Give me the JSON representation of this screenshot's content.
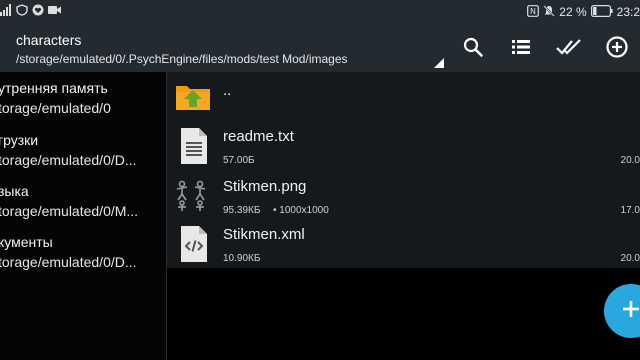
{
  "status_bar": {
    "left_icons": [
      "signal-icon",
      "shield-icon",
      "heart-icon",
      "video-icon"
    ],
    "right_icons": [
      "nfc-icon",
      "mute-icon"
    ],
    "battery_text": "22 %",
    "battery_level": 22,
    "time": "23:2"
  },
  "toolbar": {
    "title": "characters",
    "path": "/storage/emulated/0/.PsychEngine/files/mods/test Mod/images",
    "actions": [
      "search-icon",
      "list-view-icon",
      "select-all-icon",
      "add-icon"
    ]
  },
  "bookmarks": [
    {
      "name": "утренняя память",
      "path": "torage/emulated/0"
    },
    {
      "name": "грузки",
      "path": "torage/emulated/0/D..."
    },
    {
      "name": "зыка",
      "path": "torage/emulated/0/M..."
    },
    {
      "name": "кументы",
      "path": "torage/emulated/0/D..."
    }
  ],
  "files": [
    {
      "name": "..",
      "icon": "folder-up-icon",
      "size": "",
      "dims": "",
      "date": ""
    },
    {
      "name": "readme.txt",
      "icon": "text-file-icon",
      "size": "57.00Б",
      "dims": "",
      "date": "20.0"
    },
    {
      "name": "Stikmen.png",
      "icon": "image-thumbnail-icon",
      "size": "95.39КБ",
      "dims": "• 1000x1000",
      "date": "17.0"
    },
    {
      "name": "Stikmen.xml",
      "icon": "code-file-icon",
      "size": "10.90КБ",
      "dims": "",
      "date": "20.0"
    }
  ],
  "fab": {
    "icon": "add-icon"
  },
  "colors": {
    "accent": "#29a8e0",
    "toolbar": "#232a30",
    "folder": "#f5a623",
    "folder_arrow": "#6aa326"
  }
}
